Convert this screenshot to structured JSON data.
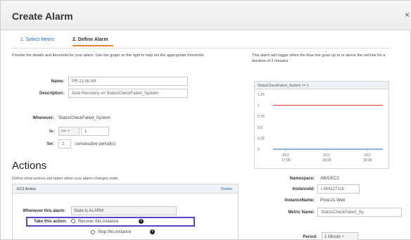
{
  "window": {
    "title": "Create Alarm",
    "close": "×"
  },
  "steps": [
    {
      "label": "1. Select Metric"
    },
    {
      "label": "2. Define Alarm"
    }
  ],
  "intro": "Provide the details and threshold for your alarm. Use the graph on the right to help set the appropriate threshold.",
  "right_intro": "This alarm will trigger when the blue line goes up to or above the red line for a duration of 2 minutes",
  "form": {
    "name_label": "Name:",
    "name_value": "PR-21-W-AR",
    "description_label": "Description:",
    "description_value": "Auto Recovery on StatusCheckFailed_System",
    "whenever_label": "Whenever:",
    "whenever_value": "StatusCheckFailed_System",
    "is_label": "is:",
    "is_operator": ">= ÷",
    "is_value": "1",
    "for_label": "for:",
    "for_value": "2",
    "for_suffix": "consecutive period(s)"
  },
  "actions": {
    "heading": "Actions",
    "description": "Define what actions are taken when your alarm changes state.",
    "panel_title": "EC2 Action",
    "delete_label": "Delete",
    "whenever_label": "Whenever this alarm:",
    "whenever_value": "State is ALARM",
    "take_label": "Take this action:",
    "option_recover": "Recover this instance",
    "option_stop": "Stop this instance",
    "info_icon": "info-circle-icon"
  },
  "chart_data": {
    "type": "line",
    "title": "StatusCheckFailed_System >= 1",
    "y_ticks": [
      "1.25",
      "1",
      "0.75",
      "0.5",
      "0.25",
      "0"
    ],
    "x_ticks": [
      {
        "date": "3/12",
        "time": "17:00"
      },
      {
        "date": "3/12",
        "time": "18:00"
      },
      {
        "date": "3/12",
        "time": "19:00"
      }
    ],
    "ylim": [
      0,
      1.25
    ],
    "series": [
      {
        "values": [
          1,
          1
        ],
        "color": "#d9534f"
      },
      {
        "values": [
          0,
          0
        ],
        "color": "#4a7fd0"
      }
    ]
  },
  "metric_info": {
    "namespace_label": "Namespace:",
    "namespace_value": "AWS/EC2",
    "instanceid_label": "InstanceId:",
    "instanceid_value": "i-3841271cb",
    "instancename_label": "InstanceName:",
    "instancename_value": "Prod-21-Web",
    "metricname_label": "Metric Name:",
    "metricname_value": "StatusCheckFailed_Sy",
    "period_label": "Period:",
    "period_value": "1 Minute  ÷"
  },
  "colors": {
    "accent": "#e8872c",
    "link": "#2a6db5",
    "highlight": "#5b3fc4"
  }
}
